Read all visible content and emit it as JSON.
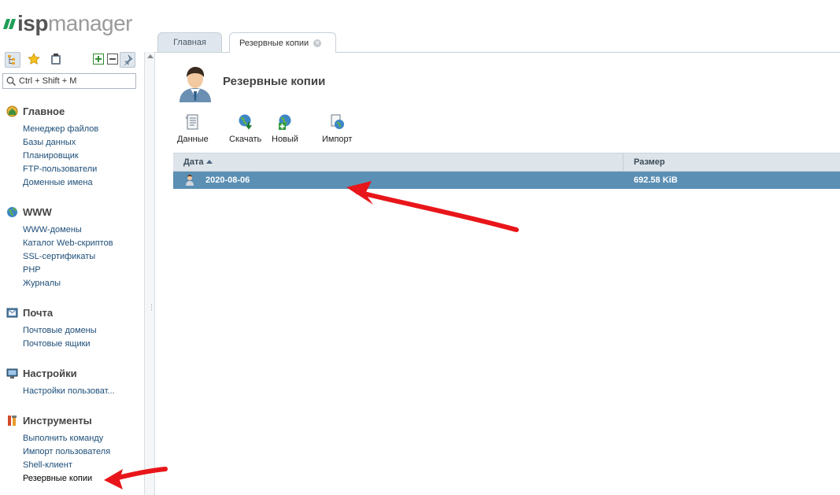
{
  "app": {
    "logo_strong": "isp",
    "logo_light": "manager"
  },
  "search": {
    "placeholder": "Ctrl + Shift + M"
  },
  "sidebar": {
    "groups": [
      {
        "title": "Главное",
        "icon": "home-icon",
        "items": [
          "Менеджер файлов",
          "Базы данных",
          "Планировщик",
          "FTP-пользователи",
          "Доменные имена"
        ]
      },
      {
        "title": "WWW",
        "icon": "globe-icon",
        "items": [
          "WWW-домены",
          "Каталог Web-скриптов",
          "SSL-сертификаты",
          "PHP",
          "Журналы"
        ]
      },
      {
        "title": "Почта",
        "icon": "mail-icon",
        "items": [
          "Почтовые домены",
          "Почтовые ящики"
        ]
      },
      {
        "title": "Настройки",
        "icon": "settings-monitor-icon",
        "items": [
          "Настройки пользоват..."
        ]
      },
      {
        "title": "Инструменты",
        "icon": "tools-icon",
        "items": [
          "Выполнить команду",
          "Импорт пользователя",
          "Shell-клиент",
          "Резервные копии"
        ]
      }
    ]
  },
  "tabs": [
    {
      "label": "Главная"
    },
    {
      "label": "Резервные копии"
    }
  ],
  "page": {
    "title": "Резервные копии"
  },
  "toolbar": {
    "data_label": "Данные",
    "download_label": "Скачать",
    "new_label": "Новый",
    "import_label": "Импорт"
  },
  "table": {
    "columns": [
      "Дата",
      "Размер"
    ],
    "rows": [
      {
        "date": "2020-08-06",
        "size": "692.58 KiB"
      }
    ]
  },
  "colors": {
    "accent": "#1f9e57",
    "row_selected": "#5b8fb4",
    "arrow": "#e8161a"
  }
}
